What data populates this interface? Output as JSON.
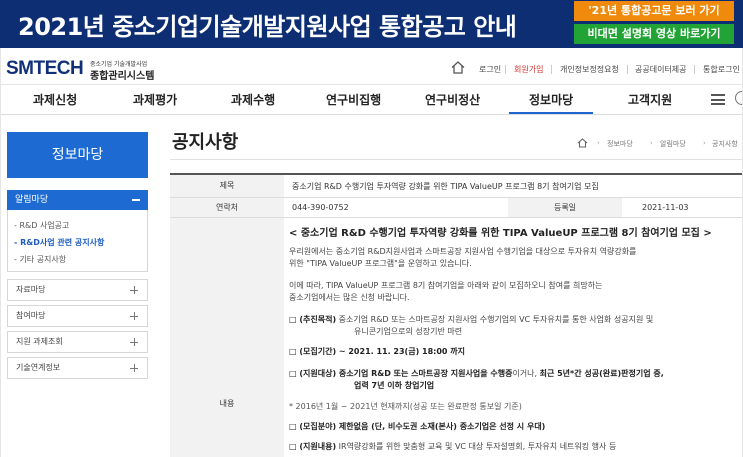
{
  "banner": {
    "title": "2021년 중소기업기술개발지원사업 통합공고 안내",
    "btn_notice": "'21년 통합공고문 보러 가기",
    "btn_video": "비대면 설명회 영상 바로가기"
  },
  "logo": {
    "main": "SMTECH",
    "sub1": "중소기업 기술개발사업",
    "sub2": "종합관리시스템"
  },
  "util": {
    "login": "로그인",
    "signup": "회원가입",
    "privacy": "개인정보정정요청",
    "opendata": "공공데이터제공",
    "integrated": "통합로그인"
  },
  "gnb": [
    "과제신청",
    "과제평가",
    "과제수행",
    "연구비집행",
    "연구비정산",
    "정보마당",
    "고객지원"
  ],
  "sidebar": {
    "title": "정보마당",
    "group": "알림마당",
    "subs": [
      "R&D 사업공고",
      "R&D사업 관련 공지사항",
      "기타 공지사항"
    ],
    "items": [
      "자료마당",
      "참여마당",
      "지원 과제조회",
      "기술연계정보"
    ]
  },
  "page": {
    "title": "공지사항",
    "breadcrumb": [
      "정보마당",
      "알림마당",
      "공지사항"
    ]
  },
  "table": {
    "subject_label": "제목",
    "subject": "중소기업 R&D 수행기업 투자역량 강화를 위한 TIPA ValueUP 프로그램 8기 참여기업 모집",
    "contact_label": "연락처",
    "contact": "044-390-0752",
    "date_label": "등록일",
    "date": "2021-11-03",
    "content_label": "내용"
  },
  "content": {
    "heading": "< 중소기업 R&D 수행기업 투자역량 강화를 위한 TIPA ValueUP 프로그램 8기 참여기업 모집 >",
    "intro1": "우리원에서는 중소기업 R&D지원사업과 스마트공장 지원사업 수행기업을 대상으로 투자유치 역량강화를",
    "intro2": "위한 \"TIPA ValueUP 프로그램\"을 운영하고 있습니다.",
    "intro3": "이에 따라, TIPA ValueUP 프로그램 8기 참여기업을 아래와 같이 모집하오니 참여를 희망하는",
    "intro4": "중소기업에서는 많은 신청 바랍니다.",
    "purpose_label": "□ (추진목적)",
    "purpose1": " 중소기업 R&D 또는 스마트공장 지원사업 수행기업의 VC 투자유치를 통한 사업화 성공지원 및",
    "purpose2": "유니콘기업으로의 성장기반 마련",
    "period": "□ (모집기간) ~ 2021. 11. 23(금) 18:00 까지",
    "target_label": "□ (지원대상)",
    "target_bold": " 중소기업 R&D 또는 스마트공장 지원사업을 수행중",
    "target_mid": "이거나, ",
    "target_bold2": "최근 5년*간 성공(완료)판정기업 중,",
    "target2": "업력 7년 이하 창업기업",
    "target_note": "* 2016년 1월 ~ 2021년 현재까지(성공 또는 완료판정 통보일 기준)",
    "field_label": "□ (모집분야)",
    "field_text": " 제한없음 (단, 비수도권 소재(본사) 중소기업은 선정 시 우대)",
    "support_label": "□ (지원내용)",
    "support_text": " IR역량강화를 위한 맞춤형 교육 및 VC 대상 투자설명회, 투자유치 네트워킹 행사 등"
  }
}
